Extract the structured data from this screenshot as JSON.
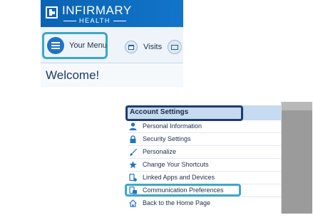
{
  "header": {
    "brand_name": "INFIRMARY",
    "brand_sub": "HEALTH",
    "menu_button_label": "Your Menu",
    "visits_label": "Visits",
    "welcome_text": "Welcome!"
  },
  "account_menu": {
    "title": "Account Settings",
    "items": [
      {
        "label": "Personal Information",
        "icon": "person-icon"
      },
      {
        "label": "Security Settings",
        "icon": "lock-icon"
      },
      {
        "label": "Personalize",
        "icon": "paintbrush-icon"
      },
      {
        "label": "Change Your Shortcuts",
        "icon": "star-icon"
      },
      {
        "label": "Linked Apps and Devices",
        "icon": "device-icon"
      },
      {
        "label": "Communication Preferences",
        "icon": "communication-icon"
      },
      {
        "label": "Back to the Home Page",
        "icon": "home-icon"
      }
    ]
  },
  "colors": {
    "brand_blue": "#0a63b3",
    "highlight_teal": "#3aa9c7",
    "highlight_navy": "#1f3c6e",
    "menu_header_bg": "#c6daf0",
    "icon_blue": "#1f73c6"
  }
}
